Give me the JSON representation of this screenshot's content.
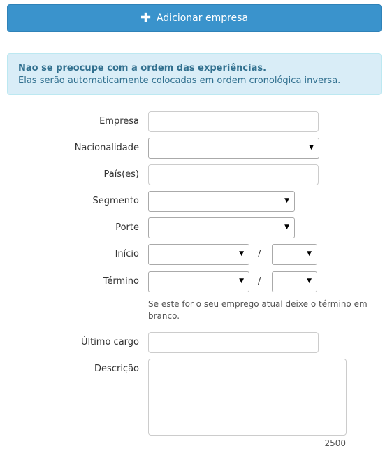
{
  "add_button": {
    "icon": "plus-icon",
    "label": "Adicionar empresa"
  },
  "alert": {
    "title": "Não se preocupe com a ordem das experiências.",
    "text": "Elas serão automaticamente colocadas em ordem cronológica inversa."
  },
  "form": {
    "empresa_label": "Empresa",
    "empresa_value": "",
    "nacionalidade_label": "Nacionalidade",
    "nacionalidade_value": "",
    "paises_label": "País(es)",
    "paises_value": "",
    "segmento_label": "Segmento",
    "segmento_value": "",
    "porte_label": "Porte",
    "porte_value": "",
    "inicio_label": "Início",
    "inicio_month": "",
    "inicio_year": "",
    "termino_label": "Término",
    "termino_month": "",
    "termino_year": "",
    "date_separator": "/",
    "termino_help": "Se este for o seu emprego atual deixe o término em branco.",
    "ultimo_cargo_label": "Último cargo",
    "ultimo_cargo_value": "",
    "descricao_label": "Descrição",
    "descricao_value": "",
    "descricao_counter": "2500"
  },
  "colors": {
    "primary_button": "#3a93cc",
    "alert_bg": "#d9edf7",
    "alert_text": "#31708f"
  }
}
